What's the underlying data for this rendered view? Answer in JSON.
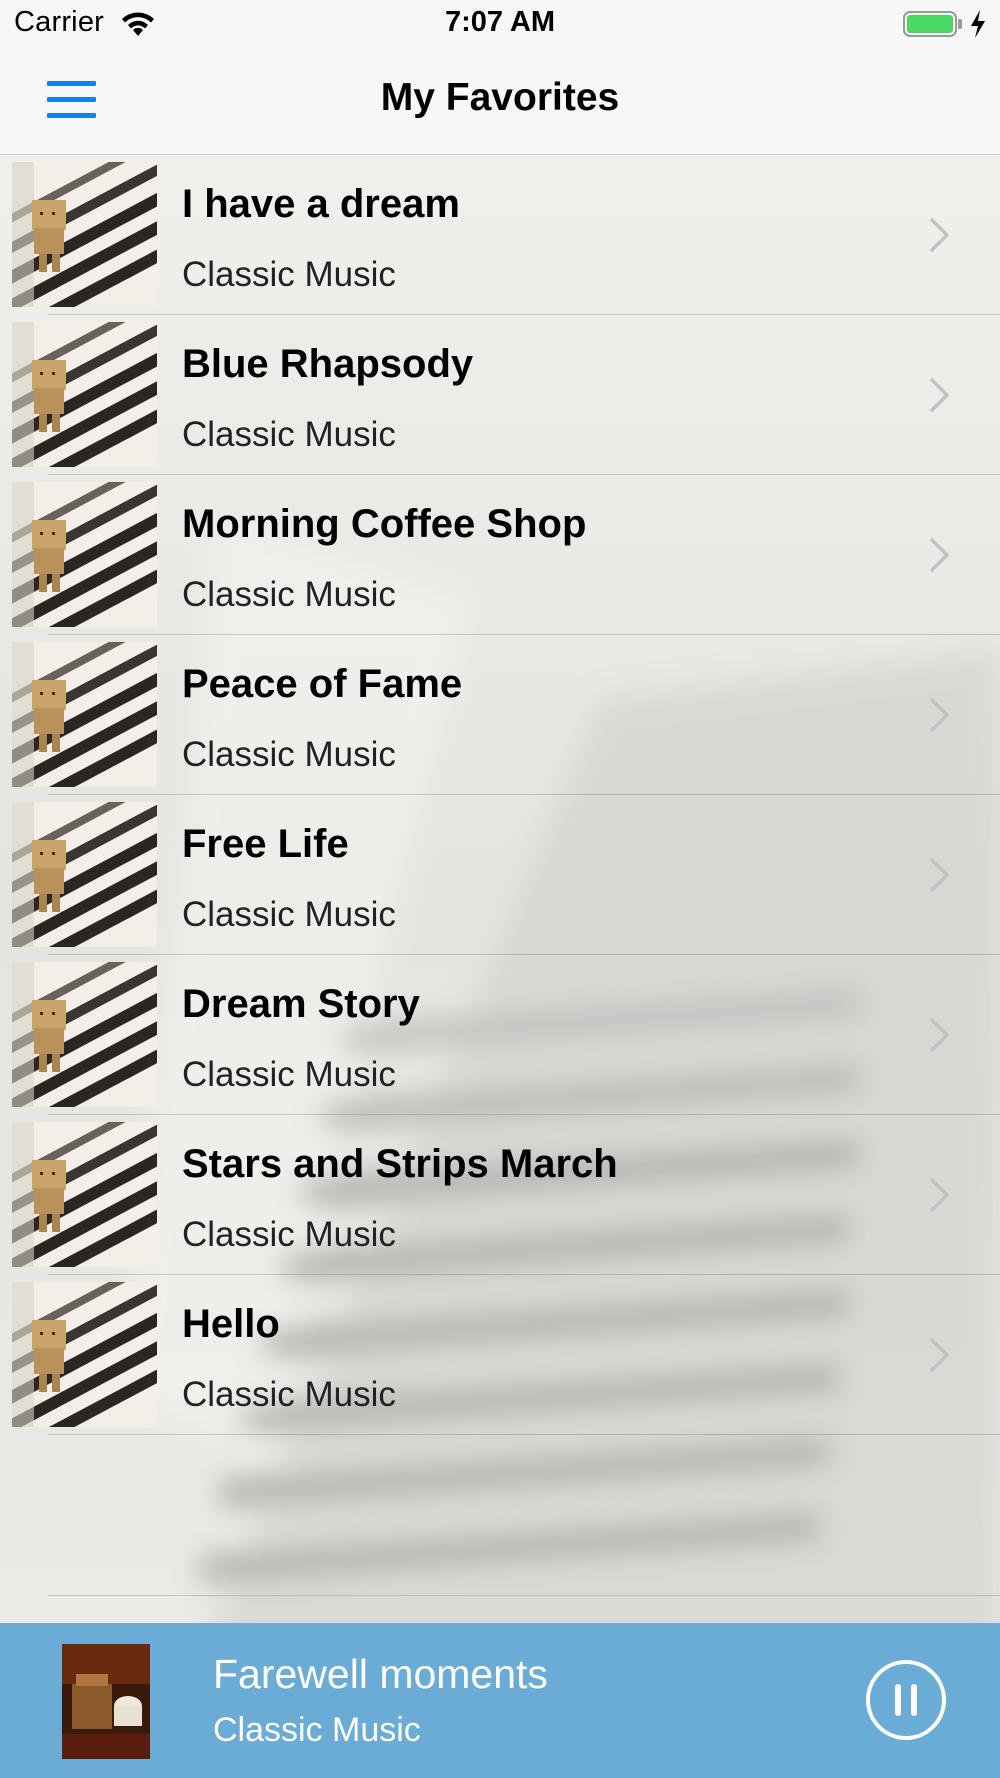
{
  "status_bar": {
    "carrier": "Carrier",
    "time": "7:07 AM",
    "battery_color": "#4cd964"
  },
  "nav": {
    "title": "My Favorites",
    "menu_icon": "hamburger-menu-icon",
    "accent_color": "#1a80f0"
  },
  "songs": [
    {
      "title": "I have a dream",
      "subtitle": "Classic Music"
    },
    {
      "title": "Blue Rhapsody",
      "subtitle": "Classic Music"
    },
    {
      "title": "Morning Coffee Shop",
      "subtitle": "Classic Music"
    },
    {
      "title": "Peace of Fame",
      "subtitle": "Classic Music"
    },
    {
      "title": "Free Life",
      "subtitle": "Classic Music"
    },
    {
      "title": "Dream Story",
      "subtitle": "Classic Music"
    },
    {
      "title": "Stars and Strips March",
      "subtitle": "Classic Music"
    },
    {
      "title": "Hello",
      "subtitle": "Classic Music"
    }
  ],
  "now_playing": {
    "title": "Farewell moments",
    "subtitle": "Classic Music",
    "control_icon": "pause-icon",
    "bar_color": "#6aacd6"
  }
}
